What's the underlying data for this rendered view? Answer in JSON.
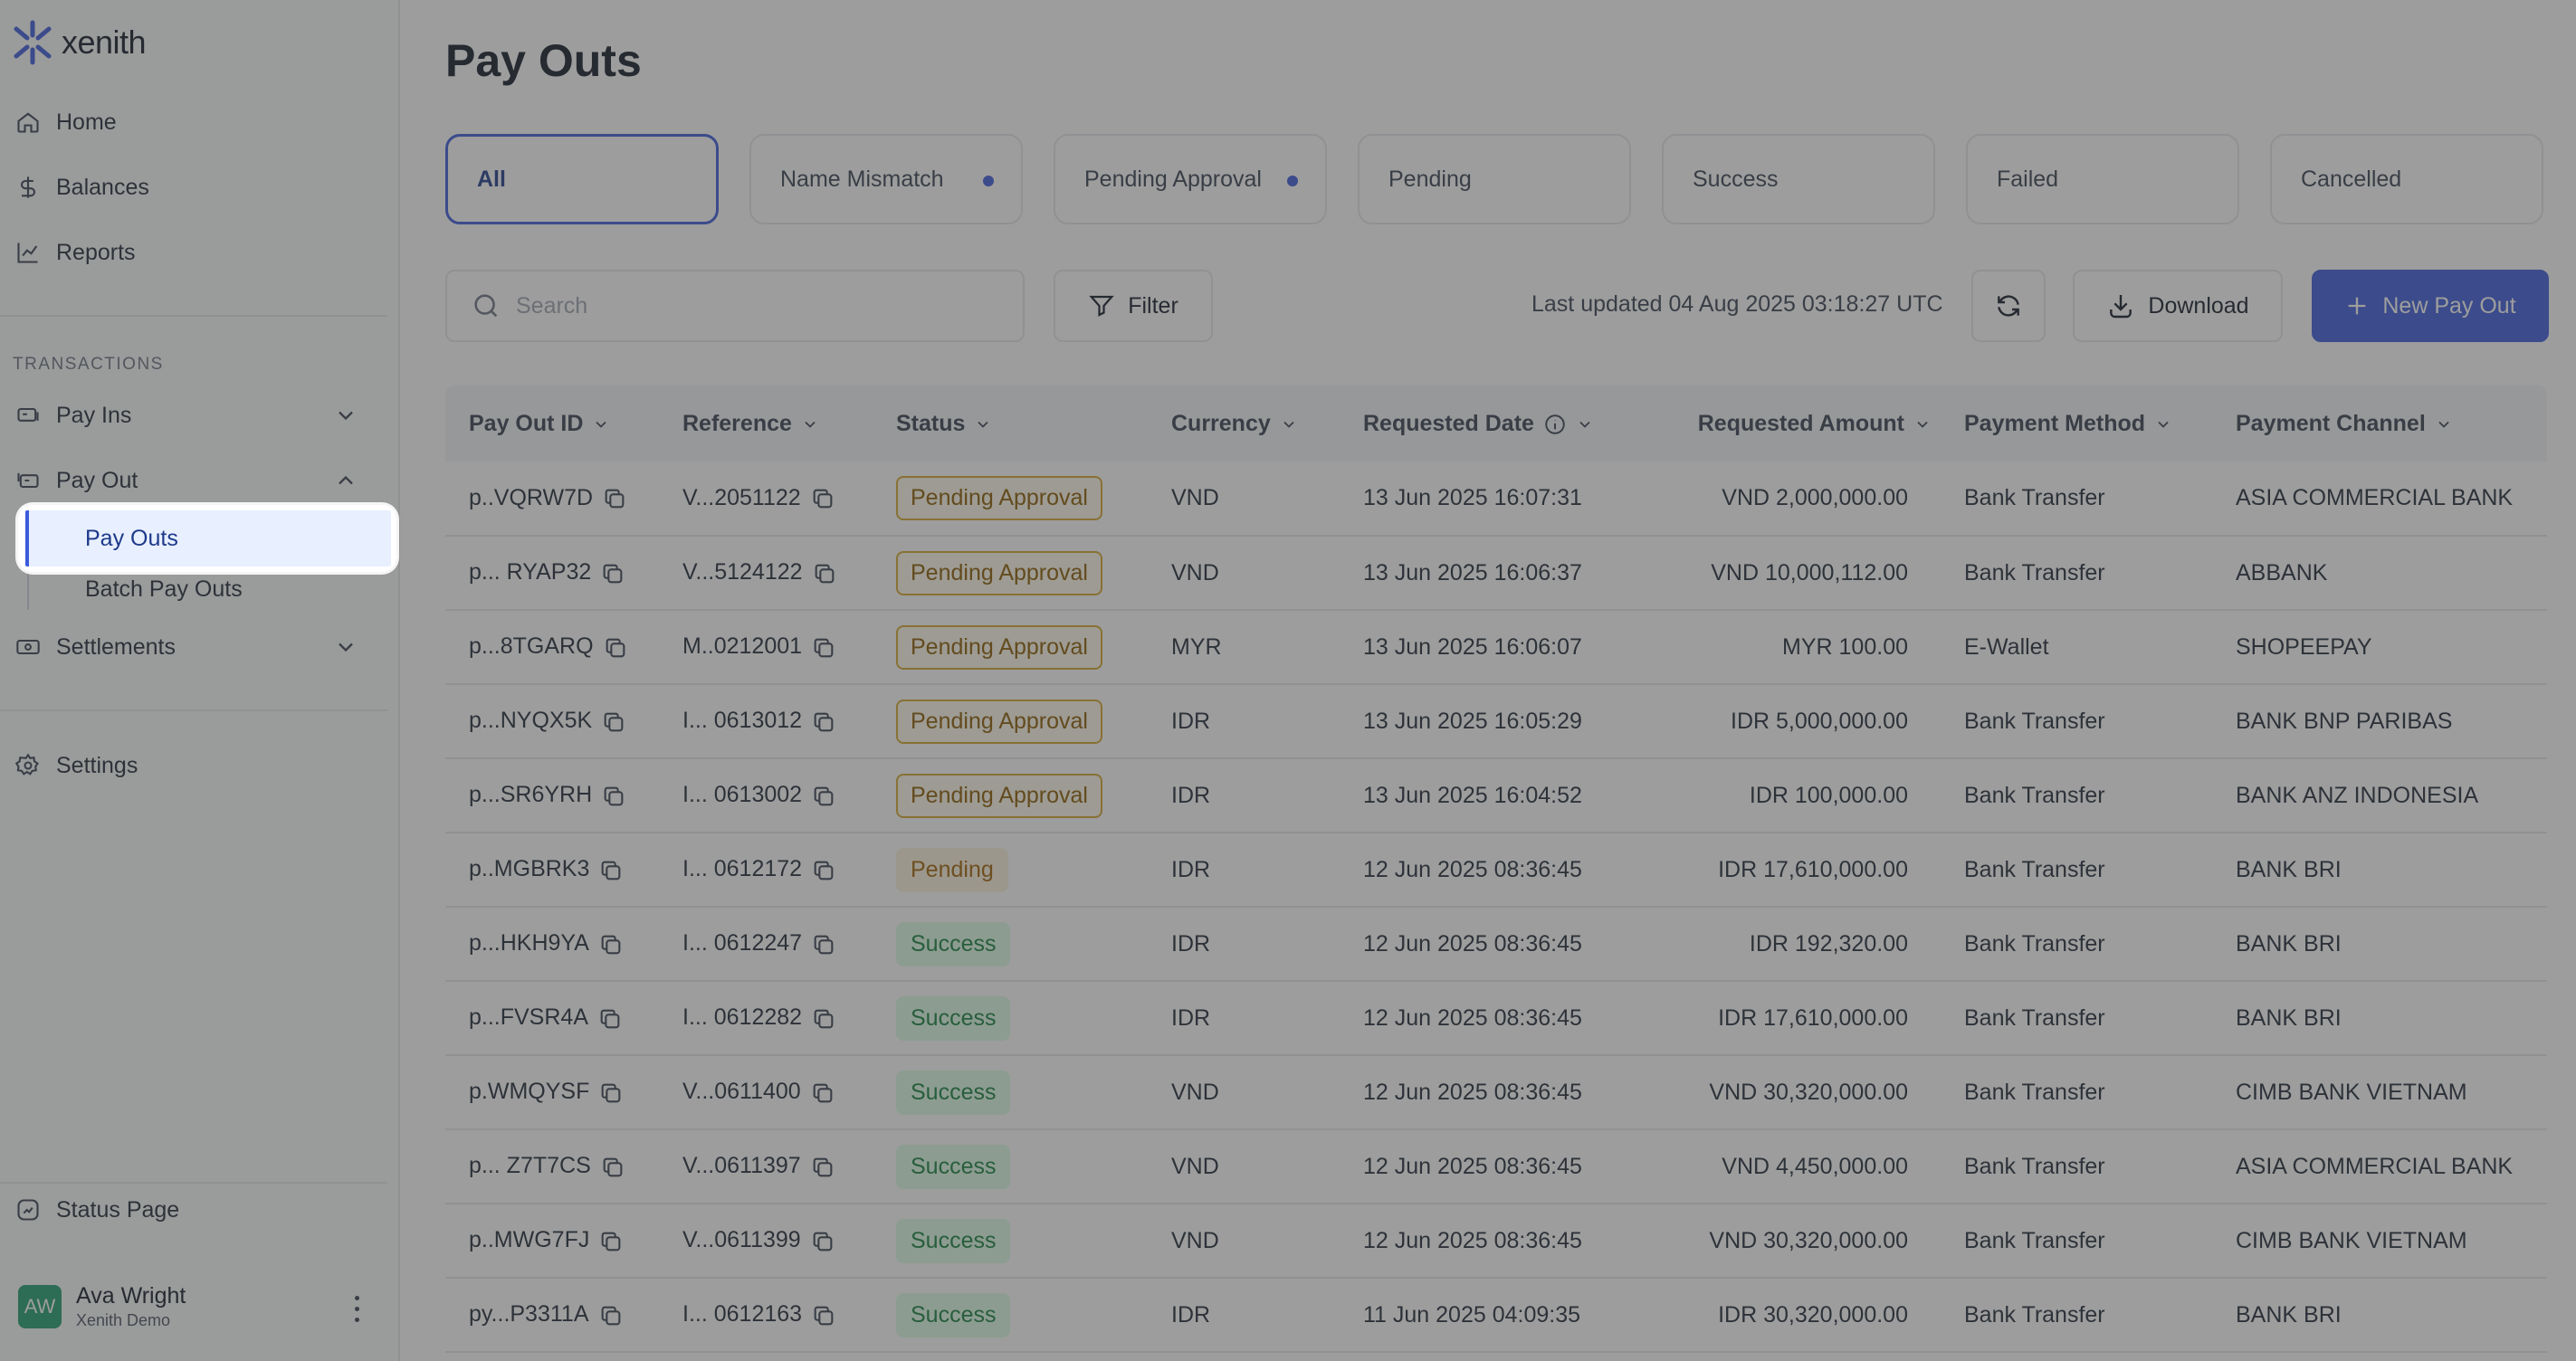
{
  "app": {
    "name": "xenith"
  },
  "sidebar": {
    "nav": [
      {
        "label": "Home"
      },
      {
        "label": "Balances"
      },
      {
        "label": "Reports"
      }
    ],
    "section_label": "TRANSACTIONS",
    "groups": {
      "pay_ins": "Pay Ins",
      "pay_out": "Pay Out",
      "settlements": "Settlements"
    },
    "pay_out_items": [
      "Pay Outs",
      "Batch Pay Outs"
    ],
    "settings": "Settings",
    "status_page": "Status Page",
    "user": {
      "initials": "AW",
      "name": "Ava Wright",
      "org": "Xenith Demo"
    }
  },
  "page": {
    "title": "Pay Outs"
  },
  "tabs": [
    {
      "label": "All"
    },
    {
      "label": "Name Mismatch"
    },
    {
      "label": "Pending Approval"
    },
    {
      "label": "Pending"
    },
    {
      "label": "Success"
    },
    {
      "label": "Failed"
    },
    {
      "label": "Cancelled"
    }
  ],
  "toolbar": {
    "search_placeholder": "Search",
    "filter_label": "Filter",
    "last_updated": "Last updated 04 Aug 2025 03:18:27 UTC",
    "download_label": "Download",
    "new_label": "New Pay Out"
  },
  "table": {
    "columns": [
      "Pay Out ID",
      "Reference",
      "Status",
      "Currency",
      "Requested Date",
      "Requested Amount",
      "Payment Method",
      "Payment Channel"
    ],
    "rows": [
      {
        "id": "p..VQRW7D",
        "ref": "V...2051122",
        "status": "Pending Approval",
        "currency": "VND",
        "date": "13 Jun 2025 16:07:31",
        "amount": "VND 2,000,000.00",
        "method": "Bank Transfer",
        "channel": "ASIA COMMERCIAL BANK"
      },
      {
        "id": "p... RYAP32",
        "ref": "V...5124122",
        "status": "Pending Approval",
        "currency": "VND",
        "date": "13 Jun 2025 16:06:37",
        "amount": "VND 10,000,112.00",
        "method": "Bank Transfer",
        "channel": "ABBANK"
      },
      {
        "id": "p...8TGARQ",
        "ref": "M..0212001",
        "status": "Pending Approval",
        "currency": "MYR",
        "date": "13 Jun 2025 16:06:07",
        "amount": "MYR 100.00",
        "method": "E-Wallet",
        "channel": "SHOPEEPAY"
      },
      {
        "id": "p...NYQX5K",
        "ref": "I... 0613012",
        "status": "Pending Approval",
        "currency": "IDR",
        "date": "13 Jun 2025 16:05:29",
        "amount": "IDR 5,000,000.00",
        "method": "Bank Transfer",
        "channel": "BANK BNP PARIBAS"
      },
      {
        "id": "p...SR6YRH",
        "ref": "I... 0613002",
        "status": "Pending Approval",
        "currency": "IDR",
        "date": "13 Jun 2025 16:04:52",
        "amount": "IDR 100,000.00",
        "method": "Bank Transfer",
        "channel": "BANK ANZ INDONESIA"
      },
      {
        "id": "p..MGBRK3",
        "ref": "I...  0612172",
        "status": "Pending",
        "currency": "IDR",
        "date": "12 Jun 2025 08:36:45",
        "amount": "IDR 17,610,000.00",
        "method": "Bank Transfer",
        "channel": "BANK BRI"
      },
      {
        "id": "p...HKH9YA",
        "ref": "I... 0612247",
        "status": "Success",
        "currency": "IDR",
        "date": "12 Jun 2025 08:36:45",
        "amount": "IDR 192,320.00",
        "method": "Bank Transfer",
        "channel": "BANK BRI"
      },
      {
        "id": "p...FVSR4A",
        "ref": "I... 0612282",
        "status": "Success",
        "currency": "IDR",
        "date": "12 Jun 2025 08:36:45",
        "amount": "IDR 17,610,000.00",
        "method": "Bank Transfer",
        "channel": "BANK BRI"
      },
      {
        "id": "p.WMQYSF",
        "ref": "V...0611400",
        "status": "Success",
        "currency": "VND",
        "date": "12 Jun 2025 08:36:45",
        "amount": "VND 30,320,000.00",
        "method": "Bank Transfer",
        "channel": "CIMB BANK VIETNAM"
      },
      {
        "id": "p... Z7T7CS",
        "ref": "V...0611397",
        "status": "Success",
        "currency": "VND",
        "date": "12 Jun 2025 08:36:45",
        "amount": "VND 4,450,000.00",
        "method": "Bank Transfer",
        "channel": "ASIA COMMERCIAL BANK"
      },
      {
        "id": "p..MWG7FJ",
        "ref": "V...0611399",
        "status": "Success",
        "currency": "VND",
        "date": "12 Jun 2025 08:36:45",
        "amount": "VND 30,320,000.00",
        "method": "Bank Transfer",
        "channel": "CIMB BANK VIETNAM"
      },
      {
        "id": "py...P3311A",
        "ref": "I... 0612163",
        "status": "Success",
        "currency": "IDR",
        "date": "11 Jun 2025 04:09:35",
        "amount": "IDR 30,320,000.00",
        "method": "Bank Transfer",
        "channel": "BANK BRI"
      }
    ]
  },
  "colors": {
    "accent": "#3b5bdb",
    "success": "#15803d",
    "pending": "#a16207",
    "avatar": "#1f9d6e"
  }
}
